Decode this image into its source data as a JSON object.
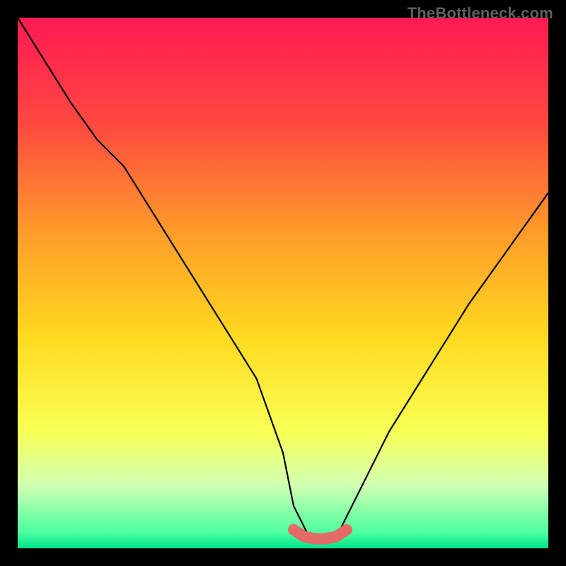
{
  "watermark": "TheBottleneck.com",
  "chart_data": {
    "type": "line",
    "title": "",
    "xlabel": "",
    "ylabel": "",
    "xlim": [
      0,
      100
    ],
    "ylim": [
      0,
      100
    ],
    "series": [
      {
        "name": "bottleneck-curve",
        "x": [
          0,
          5,
          10,
          15,
          20,
          25,
          30,
          35,
          40,
          45,
          50,
          52,
          55,
          60,
          62,
          65,
          70,
          75,
          80,
          85,
          90,
          95,
          100
        ],
        "values": [
          100,
          92,
          84,
          77,
          72,
          64,
          56,
          48,
          40,
          32,
          18,
          8,
          2,
          2,
          6,
          12,
          22,
          30,
          38,
          46,
          53,
          60,
          67
        ]
      },
      {
        "name": "optimal-zone",
        "x": [
          52,
          54,
          56,
          58,
          60,
          62
        ],
        "values": [
          3.5,
          2.2,
          1.8,
          1.8,
          2.2,
          3.5
        ]
      }
    ],
    "background_gradient": {
      "stops": [
        {
          "pos": 0.0,
          "color": "#ff1a54"
        },
        {
          "pos": 0.2,
          "color": "#ff4840"
        },
        {
          "pos": 0.4,
          "color": "#ff9a2a"
        },
        {
          "pos": 0.6,
          "color": "#ffd91f"
        },
        {
          "pos": 0.78,
          "color": "#f8ff55"
        },
        {
          "pos": 0.88,
          "color": "#d3ffb3"
        },
        {
          "pos": 0.97,
          "color": "#4dffa0"
        },
        {
          "pos": 1.0,
          "color": "#00e58a"
        }
      ]
    },
    "optimal_zone_color": "#e46a65",
    "curve_color": "#000000"
  }
}
